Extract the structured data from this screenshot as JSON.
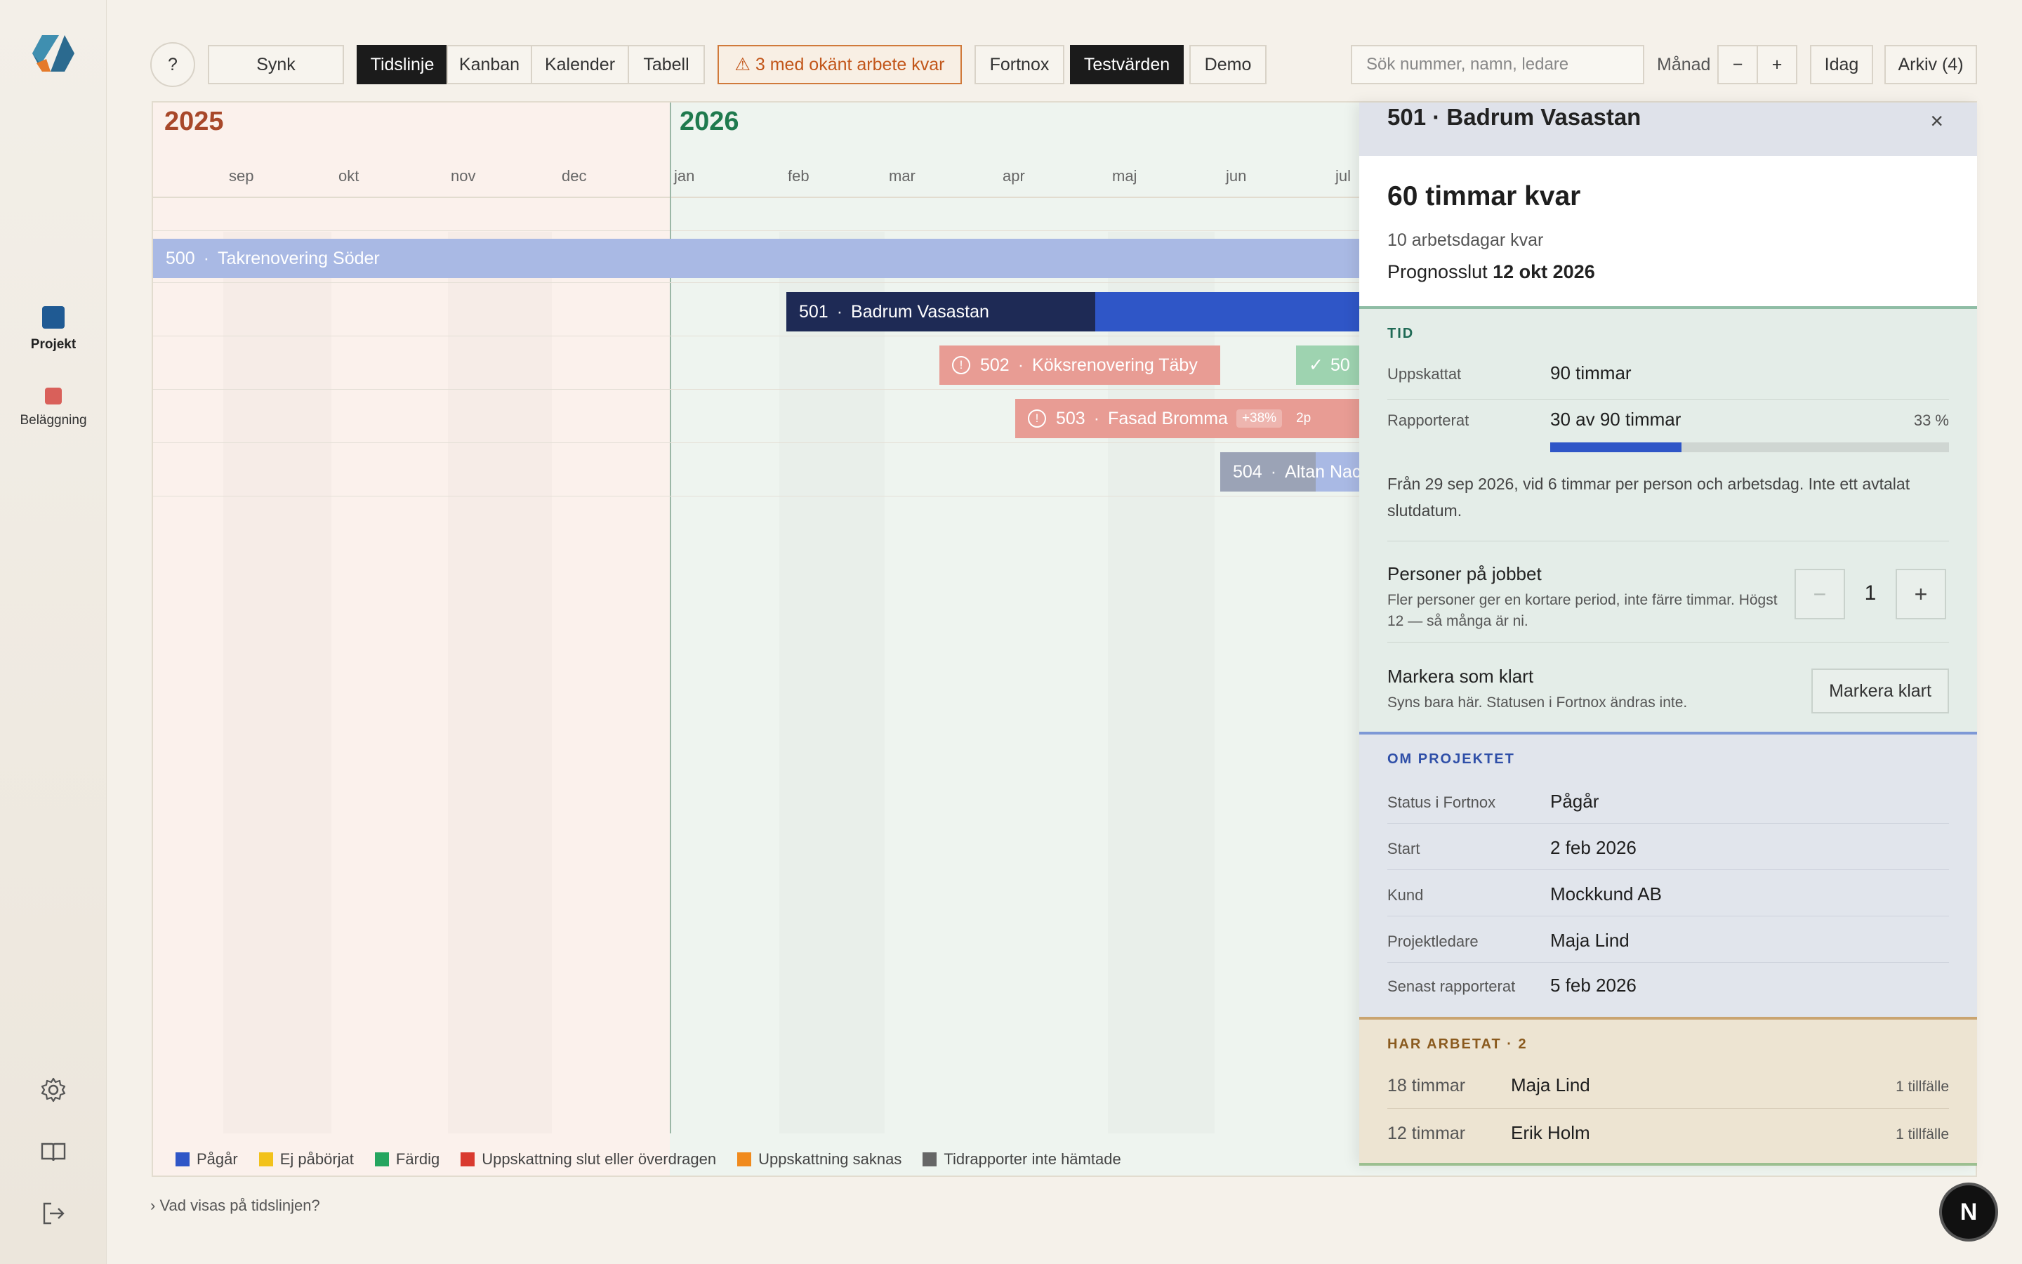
{
  "rail": {
    "items": [
      {
        "label": "Projekt",
        "color": "#1f5a93"
      },
      {
        "label": "Beläggning",
        "color": "#d9605a"
      }
    ]
  },
  "toolbar": {
    "help": "?",
    "sync": "Synk",
    "views": [
      "Tidslinje",
      "Kanban",
      "Kalender",
      "Tabell"
    ],
    "warning": "⚠  3 med okänt arbete kvar",
    "fortnox": "Fortnox",
    "testvarden": "Testvärden",
    "demo": "Demo",
    "search_placeholder": "Sök nummer, namn, ledare",
    "scale_label": "Månad",
    "zoom_out": "−",
    "zoom_in": "+",
    "today": "Idag",
    "archive": "Arkiv (4)"
  },
  "timeline": {
    "years": [
      "2025",
      "2026"
    ],
    "months_2025": [
      "sep",
      "okt",
      "nov",
      "dec"
    ],
    "months_2026": [
      "jan",
      "feb",
      "mar",
      "apr",
      "maj",
      "jun",
      "jul"
    ],
    "projects": [
      {
        "number": "500",
        "name": "Takrenovering Söder"
      },
      {
        "number": "501",
        "name": "Badrum Vasastan"
      },
      {
        "number": "502",
        "name": "Köksrenovering Täby"
      },
      {
        "number": "503",
        "name": "Fasad Bromma",
        "badge1": "+38%",
        "badge2": "2p"
      },
      {
        "number": "504",
        "name": "Altan Nac"
      }
    ],
    "done_chip": "50",
    "legend": [
      {
        "label": "Pågår",
        "color": "#2f56c7"
      },
      {
        "label": "Ej påbörjat",
        "color": "#f2c21b"
      },
      {
        "label": "Färdig",
        "color": "#25a55f"
      },
      {
        "label": "Uppskattning slut eller överdragen",
        "color": "#d93a2f"
      },
      {
        "label": "Uppskattning saknas",
        "color": "#f08a1d"
      },
      {
        "label": "Tidrapporter inte hämtade",
        "color": "#666666"
      }
    ]
  },
  "footer": {
    "help_link": "› Vad visas på tidslinjen?"
  },
  "panel": {
    "title": "501 · Badrum Vasastan",
    "close": "×",
    "remaining_hours": "60 timmar kvar",
    "remaining_days": "10 arbetsdagar kvar",
    "forecast_label": "Prognosslut",
    "forecast_value": "12 okt 2026",
    "tid": {
      "heading": "TID",
      "estimated_label": "Uppskattat",
      "estimated_value": "90 timmar",
      "reported_label": "Rapporterat",
      "reported_value": "30 av 90 timmar",
      "reported_pct": "33 %",
      "reported_fraction": 0.33,
      "description": "Från 29 sep 2026, vid 6 timmar per person och arbetsdag. Inte ett avtalat slutdatum.",
      "people_title": "Personer på jobbet",
      "people_sub": "Fler personer ger en kortare period, inte färre timmar. Högst 12 — så många är ni.",
      "people_value": "1",
      "done_title": "Markera som klart",
      "done_sub": "Syns bara här. Statusen i Fortnox ändras inte.",
      "done_button": "Markera klart"
    },
    "om": {
      "heading": "OM PROJEKTET",
      "rows": [
        {
          "label": "Status i Fortnox",
          "value": "Pågår"
        },
        {
          "label": "Start",
          "value": "2 feb 2026"
        },
        {
          "label": "Kund",
          "value": "Mockkund AB"
        },
        {
          "label": "Projektledare",
          "value": "Maja Lind"
        },
        {
          "label": "Senast rapporterat",
          "value": "5 feb 2026"
        }
      ]
    },
    "har": {
      "heading": "HAR ARBETAT · 2",
      "rows": [
        {
          "hours": "18 timmar",
          "name": "Maja Lind",
          "count": "1 tillfälle"
        },
        {
          "hours": "12 timmar",
          "name": "Erik Holm",
          "count": "1 tillfälle"
        }
      ]
    }
  },
  "fab": "N"
}
